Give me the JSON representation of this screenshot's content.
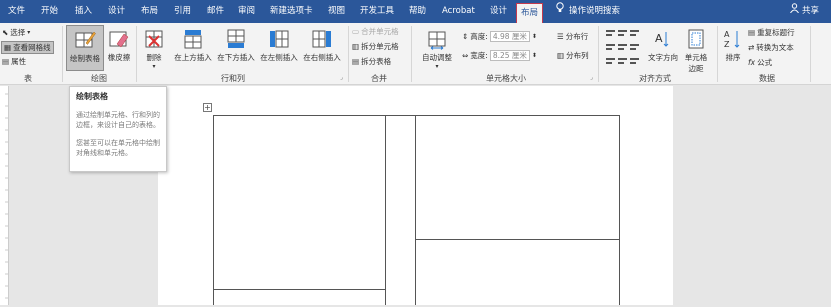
{
  "tabs": [
    "文件",
    "开始",
    "插入",
    "设计",
    "布局",
    "引用",
    "邮件",
    "审阅",
    "新建选项卡",
    "视图",
    "开发工具",
    "帮助",
    "Acrobat",
    "设计",
    "布局"
  ],
  "tell_me": "操作说明搜索",
  "share": "共享",
  "groups": {
    "table": {
      "label": "表",
      "select": "选择",
      "gridlines": "查看网格线",
      "properties": "属性"
    },
    "draw": {
      "label": "绘图",
      "draw_table": "绘制表格",
      "eraser": "橡皮擦"
    },
    "rows_cols": {
      "label": "行和列",
      "delete": "删除",
      "insert_above": "在上方插入",
      "insert_below": "在下方插入",
      "insert_left": "在左侧插入",
      "insert_right": "在右侧插入"
    },
    "merge": {
      "label": "合并",
      "merge_cells": "合并单元格",
      "split_cells": "拆分单元格",
      "split_table": "拆分表格"
    },
    "cell_size": {
      "label": "单元格大小",
      "autofit": "自动调整",
      "height_label": "高度:",
      "height_value": "4.98 厘米",
      "width_label": "宽度:",
      "width_value": "8.25 厘米",
      "distribute_rows": "分布行",
      "distribute_cols": "分布列"
    },
    "alignment": {
      "label": "对齐方式",
      "text_direction": "文字方向",
      "cell_margins": "单元格边距"
    },
    "data": {
      "label": "数据",
      "sort": "排序",
      "repeat_header": "重复标题行",
      "convert_to_text": "转换为文本",
      "formula": "公式"
    }
  },
  "tooltip": {
    "title": "绘制表格",
    "line1": "通过绘制单元格、行和列的边框，来设计自己的表格。",
    "line2": "您甚至可以在单元格中绘制对角线和单元格。"
  },
  "colors": {
    "tabbar": "#2b579a",
    "ribbon": "#f3f3f3",
    "active_tab_border": "#c23a4e",
    "canvas": "#e6e6e6"
  }
}
